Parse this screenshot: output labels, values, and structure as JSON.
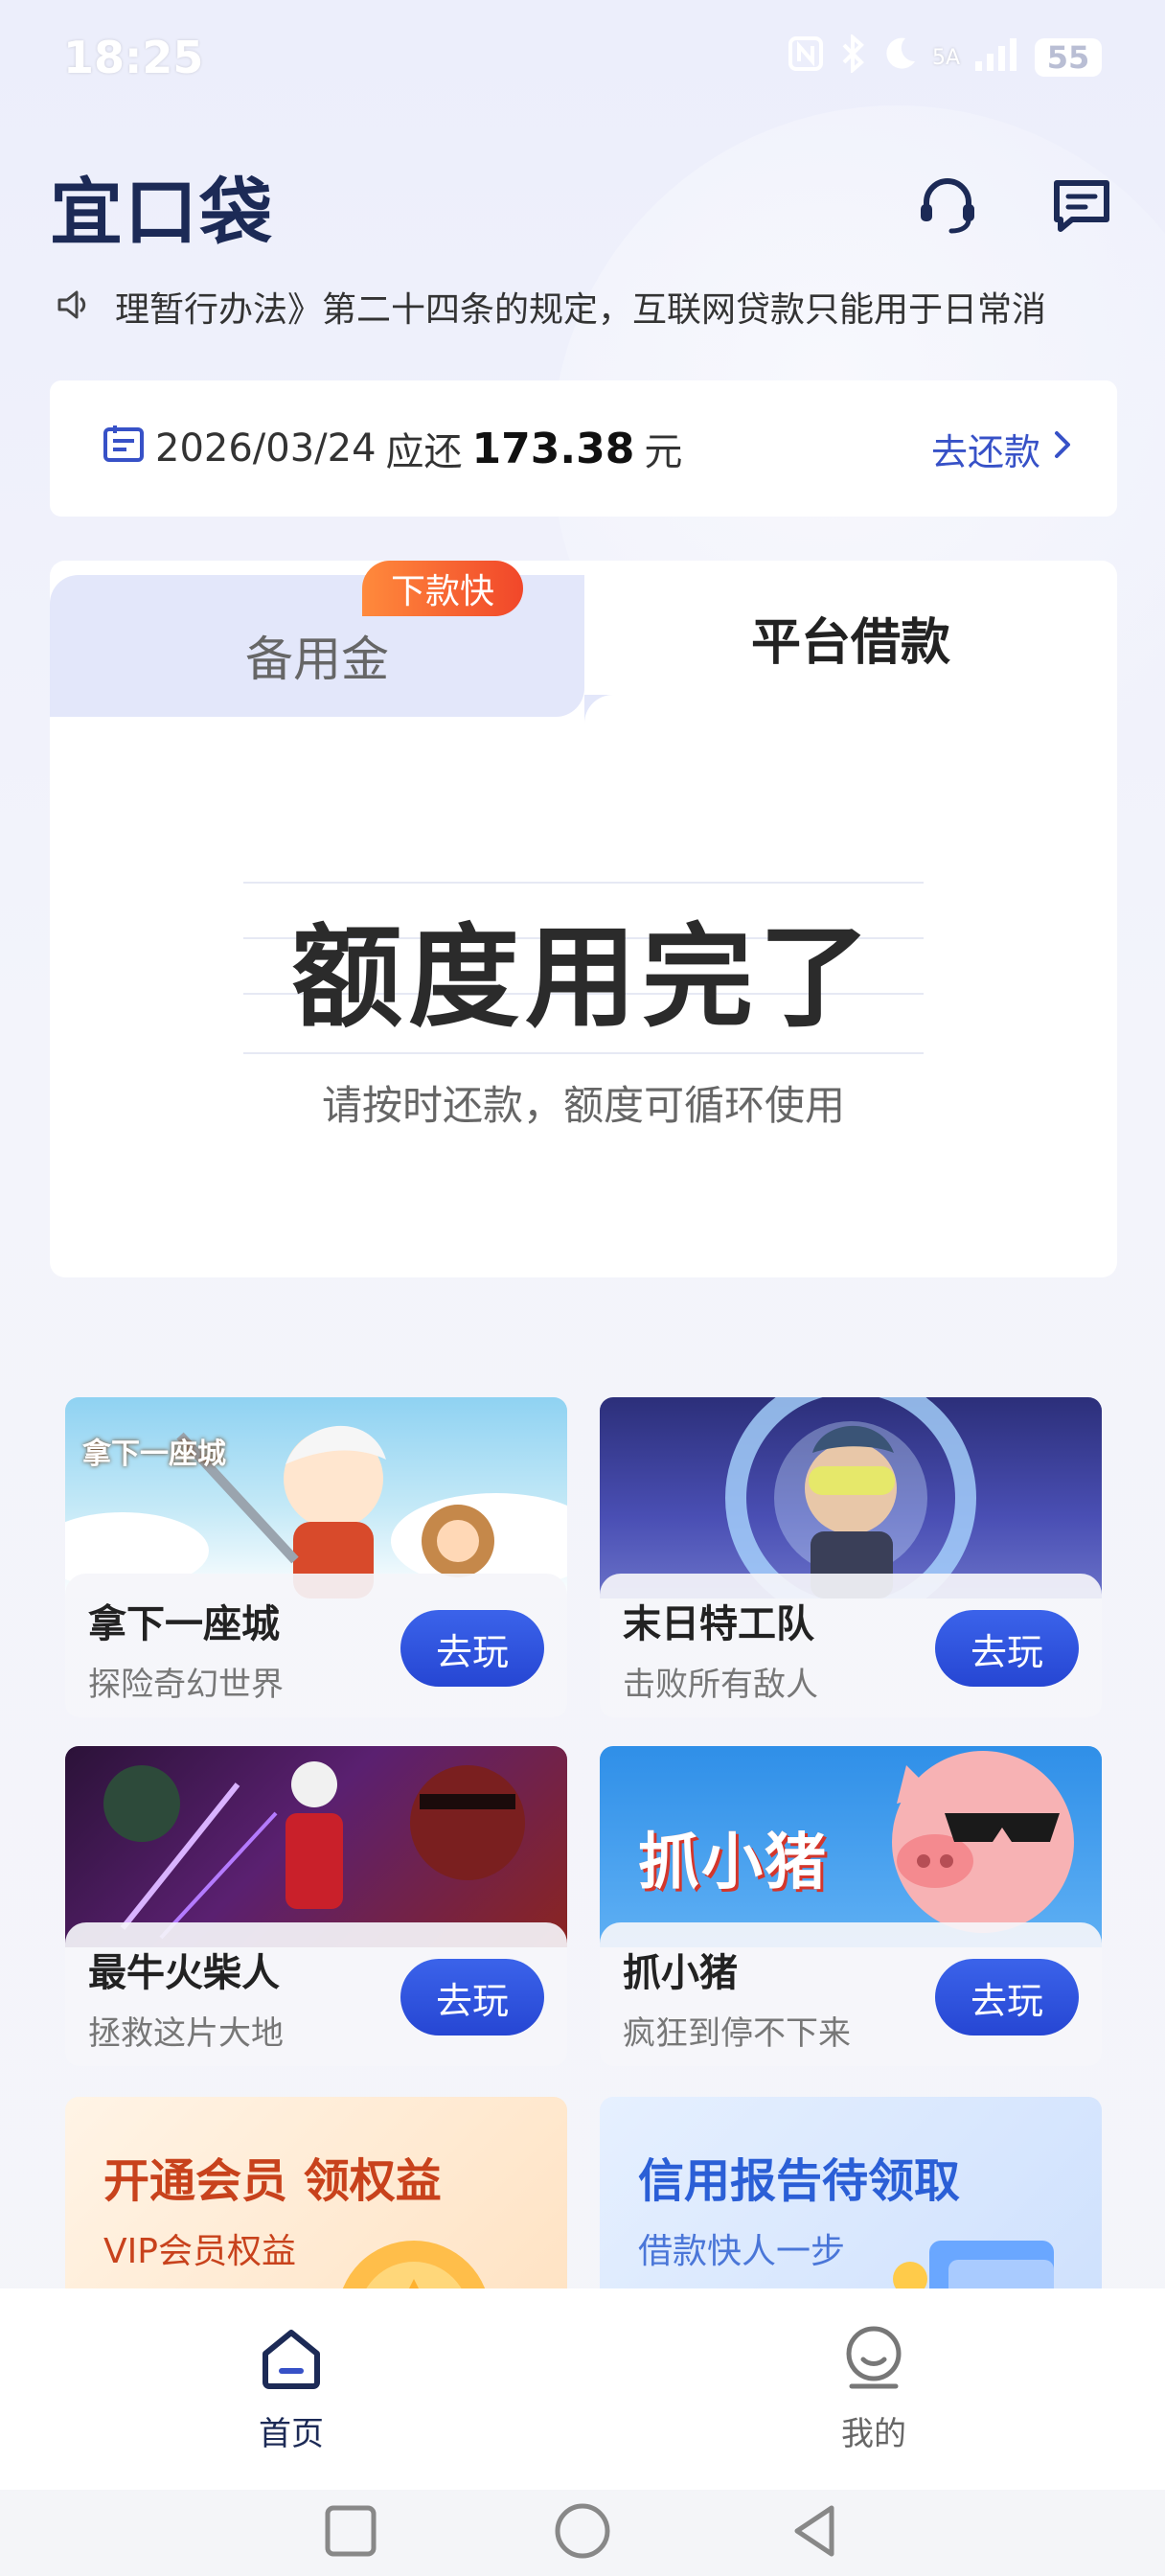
{
  "status_bar": {
    "time": "18:25",
    "signal_label": "5A",
    "battery": "55",
    "icons": [
      "nfc-icon",
      "bluetooth-icon",
      "moon-icon",
      "signal-icon",
      "battery-icon"
    ]
  },
  "header": {
    "logo": "宜口袋",
    "actions": [
      "headset-icon",
      "message-icon"
    ]
  },
  "notice": {
    "icon": "speaker-icon",
    "text": "理暂行办法》第二十四条的规定，互联网贷款只能用于日常消"
  },
  "repayment": {
    "date": "2026/03/24",
    "due_label": "应还",
    "amount": "173.38",
    "unit": "元",
    "action": "去还款"
  },
  "loan_tabs": {
    "left": {
      "label": "备用金",
      "badge": "下款快"
    },
    "right": {
      "label": "平台借款"
    }
  },
  "quota": {
    "title": "额度用完了",
    "subtitle": "请按时还款，额度可循环使用"
  },
  "games": [
    {
      "name": "拿下一座城",
      "desc": "探险奇幻世界",
      "button": "去玩",
      "art_label": "拿下一座城"
    },
    {
      "name": "末日特工队",
      "desc": "击败所有敌人",
      "button": "去玩"
    },
    {
      "name": "最牛火柴人",
      "desc": "拯救这片大地",
      "button": "去玩"
    },
    {
      "name": "抓小猪",
      "desc": "疯狂到停不下来",
      "button": "去玩",
      "art_label": "抓小猪"
    }
  ],
  "promos": [
    {
      "title": "开通会员 领权益",
      "subtitle": "VIP会员权益"
    },
    {
      "title": "信用报告待领取",
      "subtitle": "借款快人一步"
    }
  ],
  "bottom_nav": {
    "items": [
      {
        "label": "首页",
        "icon": "home-icon",
        "active": true
      },
      {
        "label": "我的",
        "icon": "profile-icon",
        "active": false
      }
    ]
  },
  "system_nav": [
    "recent-apps-icon",
    "home-circle-icon",
    "back-icon"
  ],
  "colors": {
    "brand_navy": "#1c2a56",
    "accent_blue": "#3751c7",
    "badge_orange": "#f1472a"
  }
}
